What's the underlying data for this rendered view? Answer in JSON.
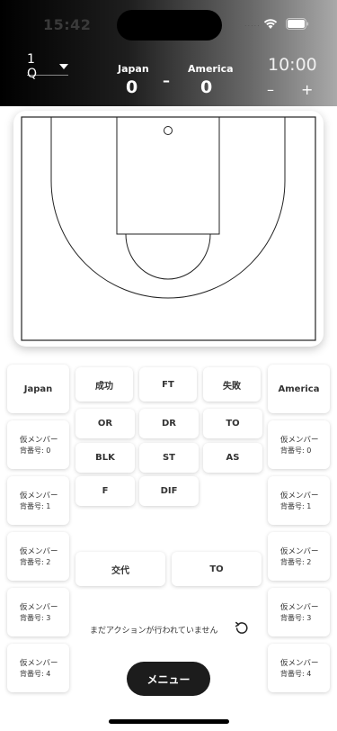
{
  "status_bar": {
    "time": "15:42",
    "signal": "....."
  },
  "header": {
    "quarter": "1 Q",
    "home_team": "Japan",
    "away_team": "America",
    "home_score": "0",
    "away_score": "0",
    "separator": "–",
    "clock": "10:00",
    "clock_minus": "–",
    "clock_plus": "+",
    "gradient_colors": [
      "#000000",
      "#a9a9a9"
    ]
  },
  "teams": {
    "left": "Japan",
    "right": "America"
  },
  "actions": {
    "success": "成功",
    "ft": "FT",
    "fail": "失敗",
    "or": "OR",
    "dr": "DR",
    "to": "TO",
    "blk": "BLK",
    "st": "ST",
    "as": "AS",
    "f": "F",
    "dif": "DIF"
  },
  "bottom_actions": {
    "substitution": "交代",
    "timeout": "TO"
  },
  "left_players": [
    {
      "name": "仮メンバー",
      "number": "背番号: 0"
    },
    {
      "name": "仮メンバー",
      "number": "背番号: 1"
    },
    {
      "name": "仮メンバー",
      "number": "背番号: 2"
    },
    {
      "name": "仮メンバー",
      "number": "背番号: 3"
    },
    {
      "name": "仮メンバー",
      "number": "背番号: 4"
    }
  ],
  "right_players": [
    {
      "name": "仮メンバー",
      "number": "背番号: 0"
    },
    {
      "name": "仮メンバー",
      "number": "背番号: 1"
    },
    {
      "name": "仮メンバー",
      "number": "背番号: 2"
    },
    {
      "name": "仮メンバー",
      "number": "背番号: 3"
    },
    {
      "name": "仮メンバー",
      "number": "背番号: 4"
    }
  ],
  "log": {
    "empty_message": "まだアクションが行われていません"
  },
  "menu": {
    "label": "メニュー"
  },
  "icons": {
    "undo": "undo-icon",
    "quarter_dropdown": "chevron-down-icon",
    "wifi": "wifi-icon",
    "battery": "battery-icon"
  }
}
